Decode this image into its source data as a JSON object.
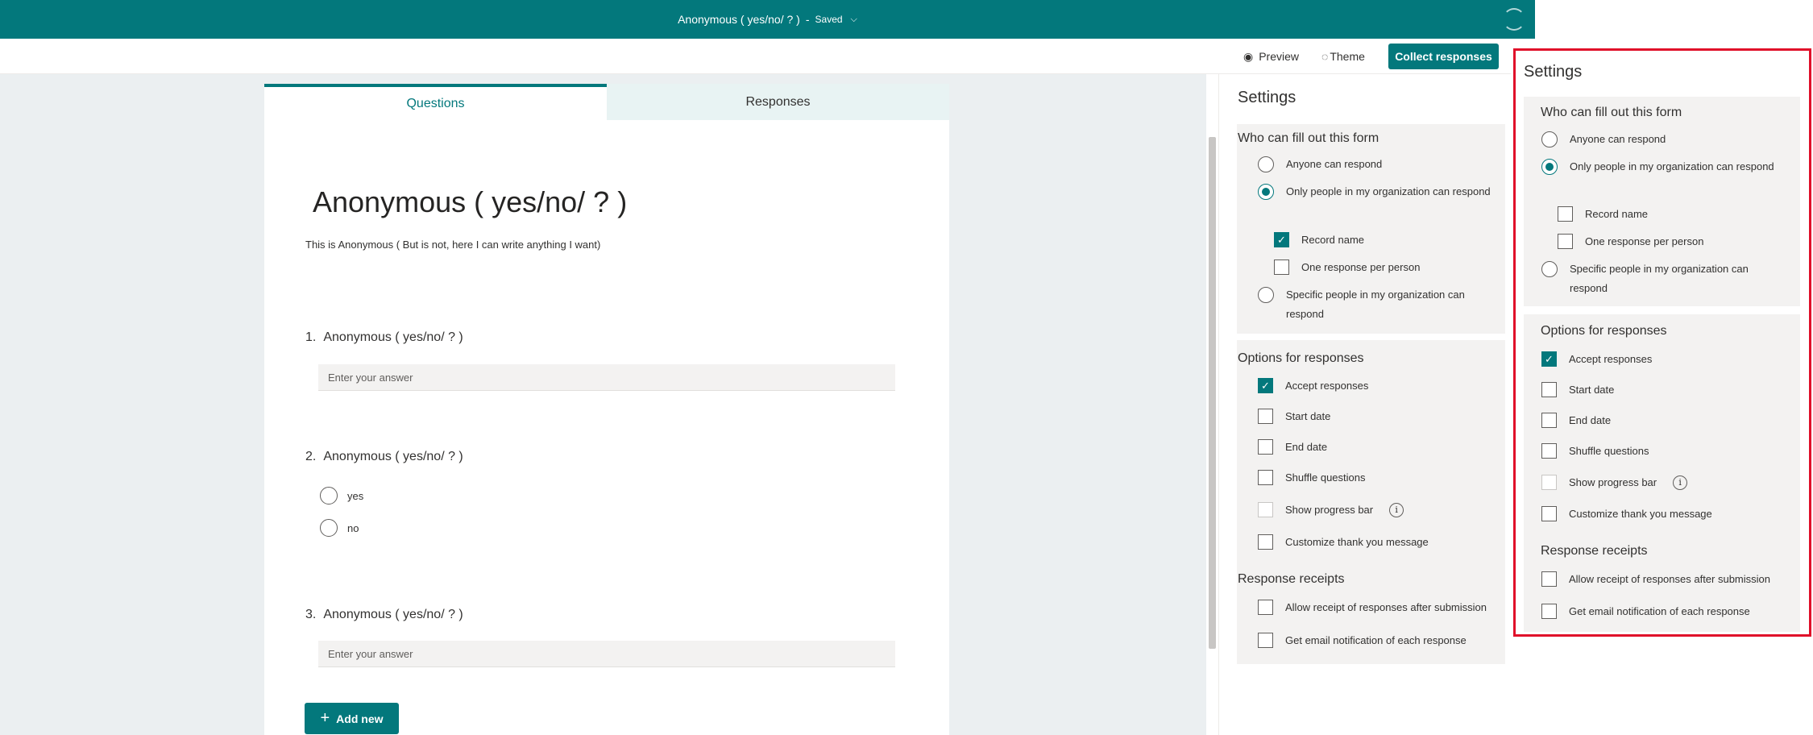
{
  "header": {
    "title": "Anonymous ( yes/no/ ? )",
    "separator": "-",
    "status": "Saved",
    "chevron": "⌵"
  },
  "toolbar": {
    "preview": "Preview",
    "theme": "Theme",
    "collect": "Collect responses",
    "preview_icon": "eye-icon",
    "theme_icon": "palette-icon"
  },
  "tabs": {
    "questions": "Questions",
    "responses": "Responses"
  },
  "form": {
    "title": "Anonymous ( yes/no/ ? )",
    "description": "This is Anonymous ( But is not,  here I can write anything I want)",
    "questions": [
      {
        "number": "1.",
        "title": "Anonymous ( yes/no/ ? )",
        "placeholder": "Enter your answer"
      },
      {
        "number": "2.",
        "title": "Anonymous ( yes/no/ ? )",
        "options": [
          "yes",
          "no"
        ]
      },
      {
        "number": "3.",
        "title": "Anonymous ( yes/no/ ? )",
        "placeholder": "Enter your answer"
      }
    ],
    "add_new": "Add new"
  },
  "settings": {
    "title": "Settings",
    "who": {
      "title": "Who can fill out this form",
      "anyone": "Anyone can respond",
      "org": "Only people in my organization can respond",
      "record_name": "Record name",
      "one_response": "One response per person",
      "specific": "Specific people in my organization can respond"
    },
    "options": {
      "title": "Options for responses",
      "accept": "Accept responses",
      "start": "Start date",
      "end": "End date",
      "shuffle": "Shuffle questions",
      "progress": "Show progress bar",
      "thankyou": "Customize thank you message"
    },
    "receipts": {
      "title": "Response receipts",
      "allow": "Allow receipt of responses after submission",
      "email": "Get email notification of each response"
    }
  },
  "settings_state_main": {
    "who": "org",
    "record_name": true,
    "one_response": false,
    "accept": true,
    "start": false,
    "end": false,
    "shuffle": false,
    "progress": false,
    "thankyou": false,
    "allow": false,
    "email": false
  },
  "settings_state_highlight": {
    "who": "org",
    "record_name": false,
    "one_response": false,
    "accept": true,
    "start": false,
    "end": false,
    "shuffle": false,
    "progress": false,
    "thankyou": false,
    "allow": false,
    "email": false
  },
  "colors": {
    "accent": "#03787c",
    "highlight": "#e0102a"
  }
}
